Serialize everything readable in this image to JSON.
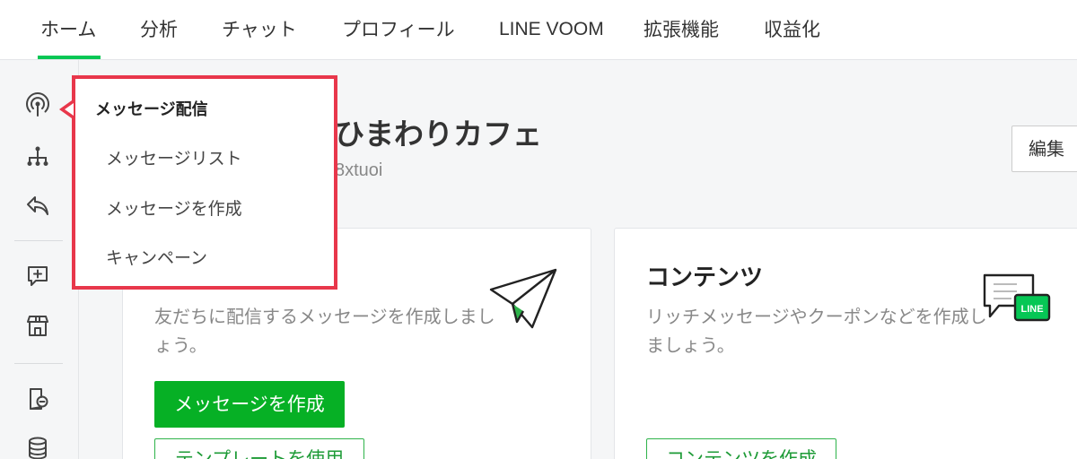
{
  "nav": {
    "tabs": [
      {
        "label": "ホーム",
        "active": true
      },
      {
        "label": "分析"
      },
      {
        "label": "チャット"
      },
      {
        "label": "プロフィール"
      },
      {
        "label": "LINE VOOM"
      },
      {
        "label": "拡張機能"
      },
      {
        "label": "収益化"
      }
    ]
  },
  "sidebar": {
    "icons": [
      "broadcast-icon",
      "sitemap-icon",
      "reply-icon",
      "add-chat-icon",
      "shop-icon",
      "card-chat-icon",
      "database-icon"
    ]
  },
  "account": {
    "name": "ひまわりカフェ",
    "id": "8xtuoi",
    "edit_label": "編集"
  },
  "cards": {
    "message": {
      "desc": "友だちに配信するメッセージを作成しましょう。",
      "primary_label": "メッセージを作成",
      "secondary_label": "テンプレートを使用"
    },
    "content": {
      "title": "コンテンツ",
      "desc": "リッチメッセージやクーポンなどを作成しましょう。",
      "button_label": "コンテンツを作成",
      "badge": "LINE"
    }
  },
  "popup": {
    "heading": "メッセージ配信",
    "items": [
      "メッセージリスト",
      "メッセージを作成",
      "キャンペーン"
    ]
  },
  "colors": {
    "brand_green": "#06c755",
    "button_green": "#06b025",
    "highlight_red": "#e8374b"
  }
}
